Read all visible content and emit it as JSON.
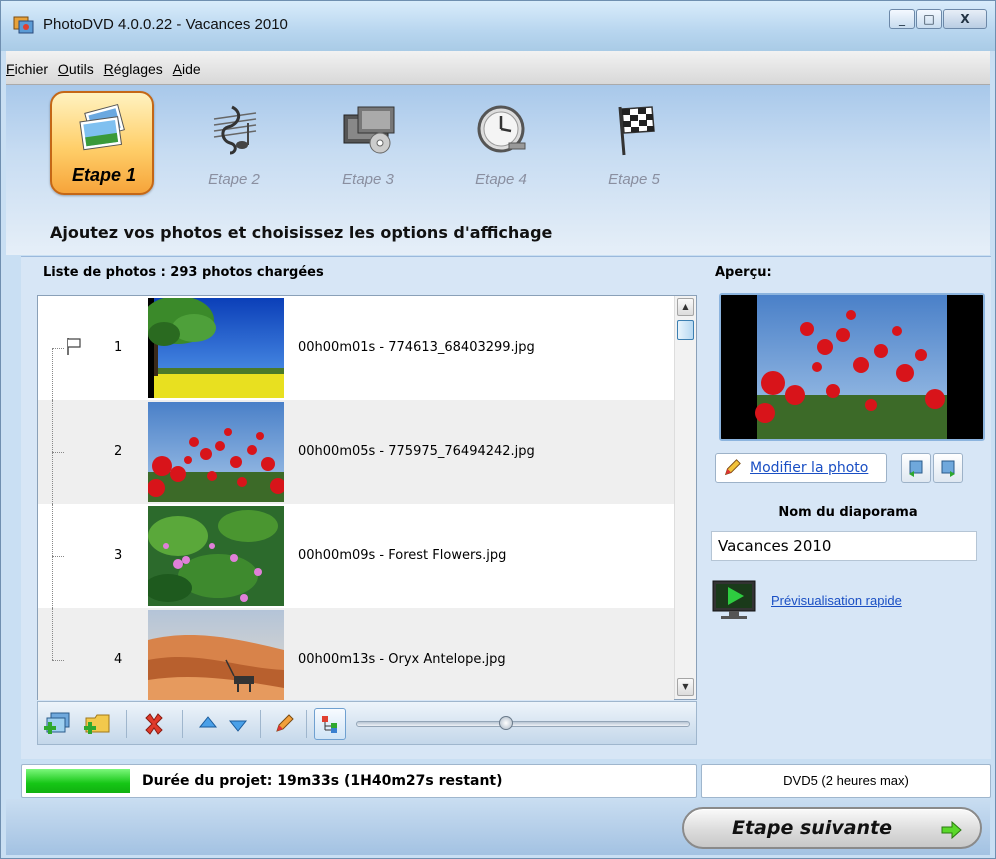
{
  "window": {
    "title": "PhotoDVD 4.0.0.22 - Vacances 2010",
    "minimize": "_",
    "maximize": "□",
    "close": "X"
  },
  "menu": [
    {
      "accel": "F",
      "rest": "ichier"
    },
    {
      "accel": "O",
      "rest": "utils"
    },
    {
      "accel": "R",
      "rest": "églages"
    },
    {
      "accel": "A",
      "rest": "ide"
    }
  ],
  "steps": [
    {
      "label": "Etape 1",
      "active": true,
      "icon": "photos-icon"
    },
    {
      "label": "Etape 2",
      "active": false,
      "icon": "music-icon"
    },
    {
      "label": "Etape 3",
      "active": false,
      "icon": "dvd-menu-icon"
    },
    {
      "label": "Etape 4",
      "active": false,
      "icon": "clock-icon"
    },
    {
      "label": "Etape 5",
      "active": false,
      "icon": "checkered-flag-icon"
    }
  ],
  "step_title": "Ajoutez vos photos et choisissez les options d'affichage",
  "photo_list": {
    "title": "Liste de photos : 293 photos chargées",
    "rows": [
      {
        "num": "1",
        "file": "00h00m01s - 774613_68403299.jpg",
        "thumb": "tree-field"
      },
      {
        "num": "2",
        "file": "00h00m05s - 775975_76494242.jpg",
        "thumb": "poppies"
      },
      {
        "num": "3",
        "file": "00h00m09s - Forest Flowers.jpg",
        "thumb": "forest-flowers"
      },
      {
        "num": "4",
        "file": "00h00m13s - Oryx Antelope.jpg",
        "thumb": "desert-oryx"
      }
    ]
  },
  "toolbar": {
    "zoom_level": 0.45
  },
  "preview": {
    "label": "Aperçu:",
    "modify_link": "Modifier la photo"
  },
  "slideshow": {
    "name_label": "Nom du diaporama",
    "name_value": "Vacances 2010",
    "quick_preview": "Prévisualisation rapide"
  },
  "status": {
    "progress": 0.16,
    "duration_text": "Durée du projet: 19m33s (1H40m27s restant)",
    "disc_type": "DVD5 (2 heures max)"
  },
  "next_button": "Etape suivante",
  "colors": {
    "accent": "#f6a43a",
    "progress": "#16c616",
    "link": "#1a4fc4"
  }
}
